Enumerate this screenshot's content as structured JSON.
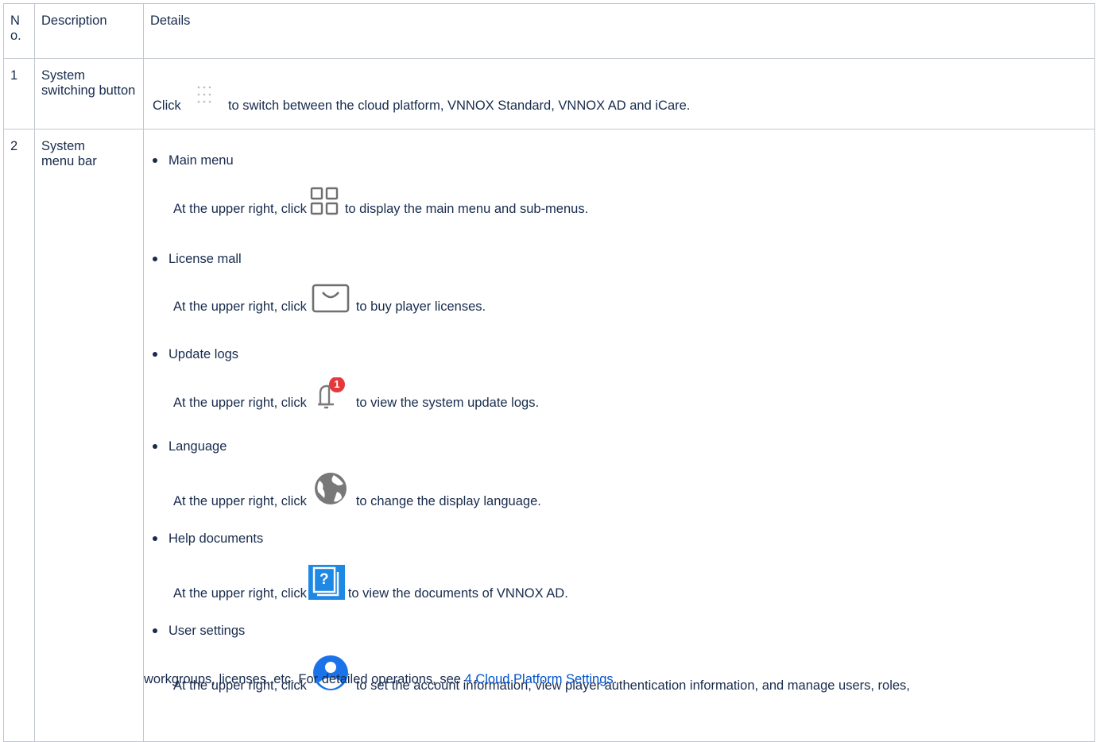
{
  "headers": {
    "no": "No.",
    "description": "Description",
    "details": "Details"
  },
  "row1": {
    "no": "1",
    "description": "System switching button",
    "before": "Click",
    "icon": "dots-grid-icon",
    "after": "to switch between the cloud platform, VNNOX Standard, VNNOX AD and iCare."
  },
  "row2": {
    "no": "2",
    "description": "System menu bar",
    "items": [
      {
        "title": "Main menu",
        "prefix": "At the upper right, click",
        "icon": "four-squares-icon",
        "suffix": "to display the main menu and sub-menus."
      },
      {
        "title": "License mall",
        "prefix": "At the upper right, click",
        "icon": "shopping-bag-icon",
        "suffix": "to buy player licenses."
      },
      {
        "title": "Update logs",
        "prefix": "At the upper right, click",
        "icon": "bell-badge-icon",
        "suffix": "to view the system update logs.",
        "badge": "1"
      },
      {
        "title": "Language",
        "prefix": "At the upper right, click",
        "icon": "globe-icon",
        "suffix": "to change the display language."
      },
      {
        "title": "Help documents",
        "prefix": "At the upper right, click",
        "icon": "help-doc-icon",
        "suffix": "to view the documents of VNNOX AD.",
        "glyph": "?"
      },
      {
        "title": "User settings",
        "prefix": "At the upper right, click",
        "icon": "user-avatar-icon",
        "suffix": "to set the account information, view player authentication information, and manage users, roles,",
        "cont_before": "workgroups, licenses, etc. For detailed operations, see",
        "link": "4 Cloud Platform Settings",
        "cont_after": "."
      }
    ]
  },
  "colors": {
    "border": "#c1c7d0",
    "text": "#172b4d",
    "link": "#0052cc",
    "badge": "#e5383b",
    "help": "#1e88e5",
    "icon_gray": "#757575"
  }
}
